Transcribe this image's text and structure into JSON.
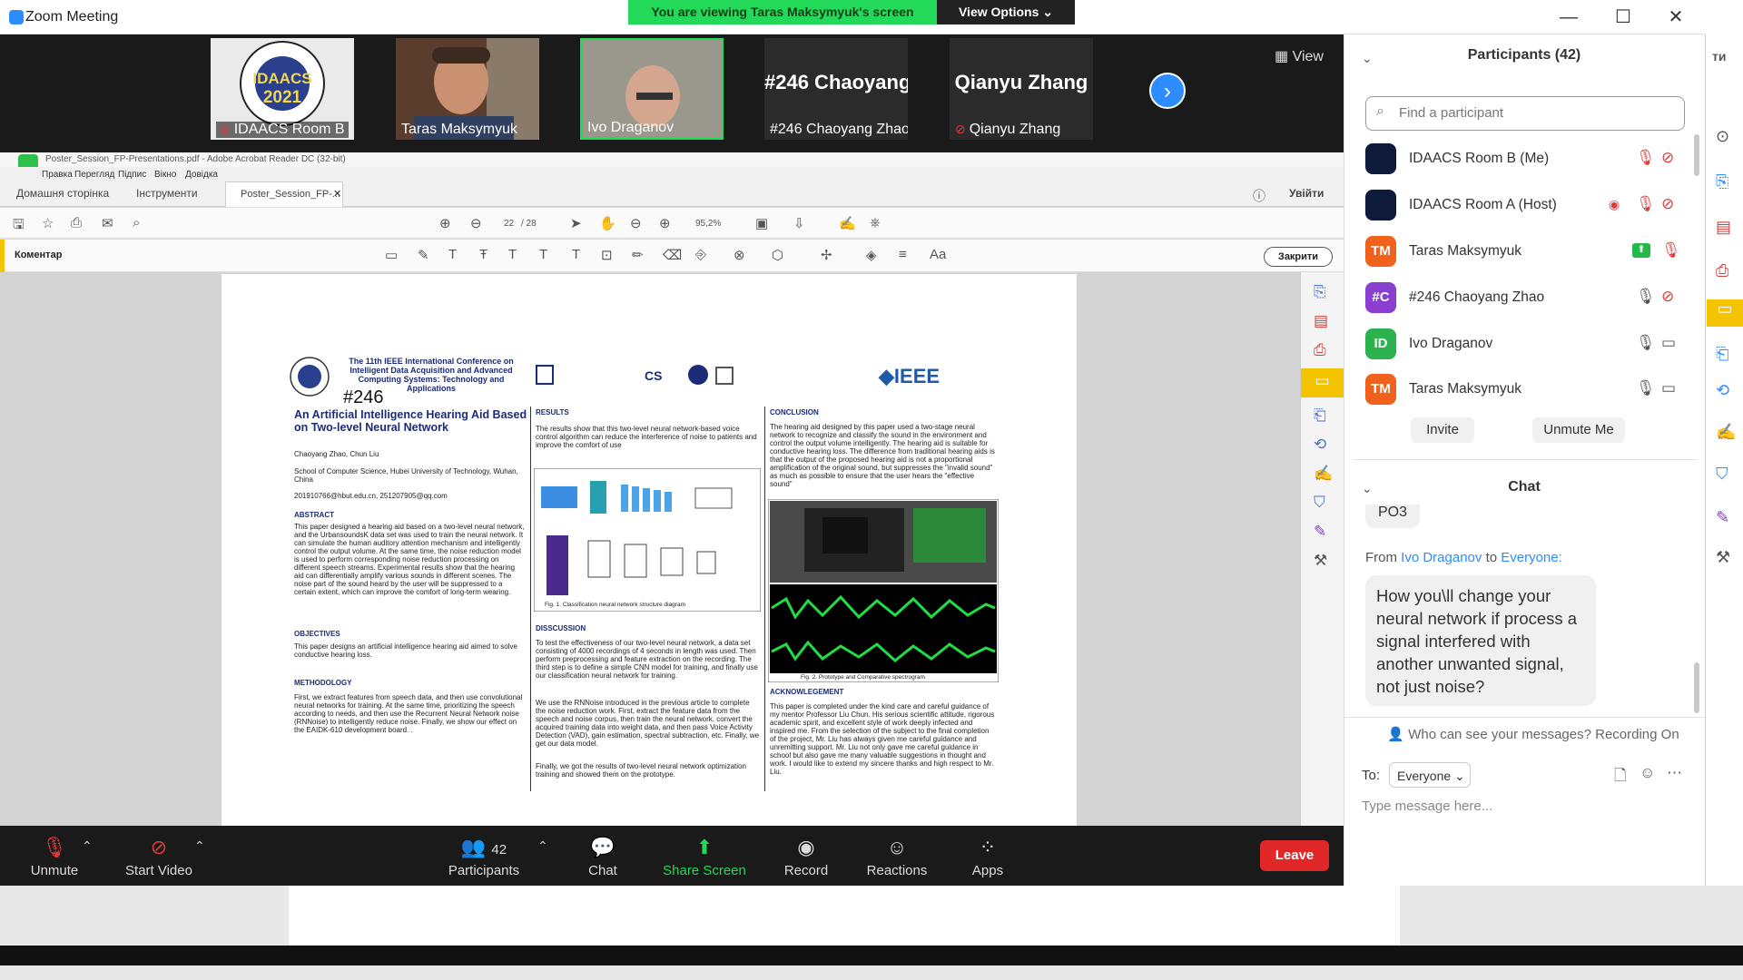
{
  "window": {
    "title": "Zoom Meeting",
    "banner": "You are viewing Taras Maksymyuk's screen",
    "view_options": "View Options",
    "minimize": "—",
    "maximize": "☐",
    "close": "✕"
  },
  "video_strip": {
    "view_label": "View",
    "tiles": [
      {
        "name": "IDAACS Room B",
        "logo_year": "2021",
        "logo_name": "IDAACS"
      },
      {
        "name": "Taras Maksymyuk"
      },
      {
        "name": "Ivo Draganov"
      },
      {
        "name": "#246  Chaoyang Zhao",
        "big": "#246  Chaoyang..."
      },
      {
        "name": "Qianyu Zhang",
        "big": "Qianyu Zhang"
      }
    ]
  },
  "acrobat": {
    "title": "Poster_Session_FP-Presentations.pdf - Adobe Acrobat Reader DC (32-bit)",
    "menu": [
      "Правка",
      "Перегляд",
      "Підпис",
      "Вікно",
      "Довідка"
    ],
    "tabs": [
      "Домашня сторінка",
      "Інструменти",
      "Poster_Session_FP-..."
    ],
    "signin": "Увійти",
    "page_current": "22",
    "page_total": "/ 28",
    "zoom": "95,2%",
    "comment_label": "Коментар",
    "close_label": "Закрити"
  },
  "poster": {
    "conference": "The 11th IEEE International Conference on Intelligent Data Acquisition and Advanced Computing Systems: Technology and Applications",
    "number": "#246",
    "title": "An Artificial Intelligence Hearing Aid Based on Two-level Neural Network",
    "authors": "Chaoyang Zhao, Chun Liu",
    "affiliation": "School of Computer Science, Hubei University of Technology, Wuhan, China",
    "emails": "201910766@hbut.edu.cn, 251207905@qq.com",
    "abstract_h": "ABSTRACT",
    "abstract": "This paper designed a hearing aid based on a two-level neural network, and the UrbansoundsK data set was used to train the neural network. It can simulate the human auditory attention mechanism and intelligently control the output volume. At the same time, the noise reduction model is used to perform corresponding noise reduction processing on different speech streams. Experimental results show that the hearing aid can differentially amplify various sounds in different scenes. The noise part of the sound heard by the user will be suppressed to a certain extent, which can improve the comfort of long-term wearing.",
    "objectives_h": "OBJECTIVES",
    "objectives": "This paper designs an artificial intelligence hearing aid aimed to solve conductive hearing loss.",
    "methodology_h": "METHODOLOGY",
    "methodology": "First, we extract features from speech data, and then use convolutional neural networks for training. At the same time, prioritizing the speech according to needs, and then use the Recurrent Neural Network noise (RNNoise) to intelligently reduce noise. Finally, we show our effect on the EAIDK-610 development board. .",
    "results_h": "RESULTS",
    "results": "The results show that this two-level neural network-based voice control algorithm can reduce the interference of noise to patients and improve the comfort of use",
    "fig1": "Fig. 1.  Classification neural network structure diagram",
    "discussion_h": "DISSCUSSION",
    "discussion1": "To test the effectiveness of our two-level neural network, a data set consisting of 4000 recordings of 4 seconds in length was used. Then perform preprocessing and feature extraction on the recording. The third step is to define a simple CNN model for training,  and finally use our classification neural network for training.",
    "discussion2": "We use the RNNoise introduced in the previous article to complete the noise reduction work. First, extract the feature data from the speech and noise corpus, then train the neural network, convert the acquired training data into weight data, and then pass Voice Activity Detection (VAD), gain estimation, spectral subtraction, etc. Finally, we get our data model.",
    "discussion3": " Finally, we got the results of two-level neural network optimization training and showed them on the prototype.",
    "conclusion_h": "CONCLUSION",
    "conclusion": "The hearing aid designed by this paper used a two-stage neural network to recognize and classify the sound in the environment and control the output volume intelligently. The hearing aid is suitable for conductive hearing loss. The difference from traditional hearing aids is that the output of the proposed hearing aid is not a proportional amplification of the original sound, but suppresses the \"invalid sound\" as much as possible to ensure that the user hears the \"effective sound\"",
    "fig2": "Fig. 2.  Prototype and Comparative spectrogram",
    "ack_h": "ACKNOWLEGEMENT",
    "ack": "This paper is completed under the kind care and careful guidance of my mentor Professor Liu Chun. His serious scientific attitude, rigorous academic spirit, and excellent style of work deeply infected and inspired me. From the selection of the subject to the final completion of the project, Mr. Liu has always given me careful guidance and unremitting support. Mr. Liu not only gave me careful guidance in school but also gave me many valuable suggestions in thought and work. I would like to extend my sincere thanks and high respect to Mr. Liu.",
    "ieee": "IEEE",
    "cs_logo": "CS"
  },
  "toolbar": {
    "unmute": "Unmute",
    "start_video": "Start Video",
    "participants": "Participants",
    "participants_count": "42",
    "chat": "Chat",
    "share_screen": "Share Screen",
    "record": "Record",
    "reactions": "Reactions",
    "apps": "Apps",
    "leave": "Leave"
  },
  "participants_panel": {
    "title": "Participants (42)",
    "search_placeholder": "Find a participant",
    "list": [
      {
        "name": "IDAACS Room B (Me)",
        "initials": "",
        "color": "#0d1a3a"
      },
      {
        "name": "IDAACS Room A (Host)",
        "initials": "",
        "color": "#0d1a3a"
      },
      {
        "name": "Taras Maksymyuk",
        "initials": "TM",
        "color": "#f0621c"
      },
      {
        "name": "#246  Chaoyang Zhao",
        "initials": "#C",
        "color": "#8a3fd1"
      },
      {
        "name": "Ivo Draganov",
        "initials": "ID",
        "color": "#2bb24c"
      },
      {
        "name": "Taras Maksymyuk",
        "initials": "TM",
        "color": "#f0621c"
      }
    ],
    "invite": "Invite",
    "unmute_me": "Unmute Me"
  },
  "chat_panel": {
    "title": "Chat",
    "prev_fragment": "PO3",
    "from_prefix": "From",
    "from_name": "Ivo Draganov",
    "to_word": "to",
    "to_name": "Everyone:",
    "message": "How you\\ll change your neural network if process a signal interfered with another unwanted signal, not just noise?",
    "who_can_see": "Who can see your messages? Recording On",
    "to_label": "To:",
    "recipient": "Everyone",
    "placeholder": "Type message here..."
  },
  "colors": {
    "zoom_blue": "#2d8cff",
    "banner_green": "#23d959",
    "leave_red": "#e02828",
    "share_green": "#23d959",
    "muted_red": "#e03a3a"
  }
}
